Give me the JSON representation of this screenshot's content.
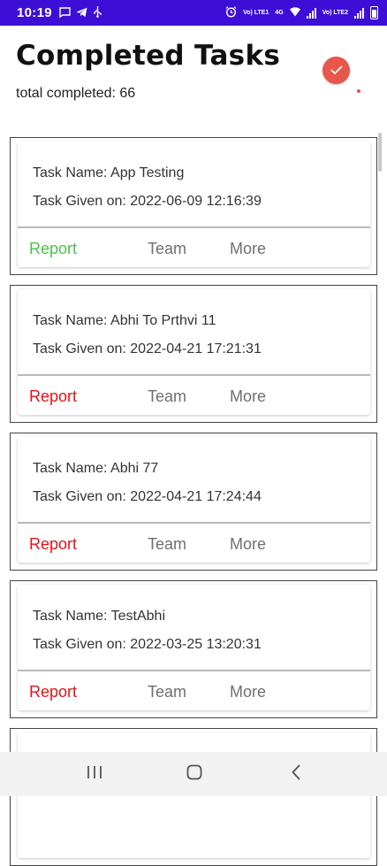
{
  "status_bar": {
    "time": "10:19",
    "left_icons": [
      "message-icon",
      "telegram-icon",
      "usb-icon"
    ],
    "right_icons": [
      "alarm-icon",
      "signal-lte1-icon",
      "wifi-icon",
      "signal-lte2-icon",
      "battery-icon"
    ],
    "network_label_1": "Vo) LTE1",
    "network_label_2": "4G",
    "network_label_3": "Vo) LTE2"
  },
  "header": {
    "title": "Completed Tasks",
    "total_label": "total completed: 66",
    "accent_color": "#e8574a"
  },
  "tasks": [
    {
      "name_line": "Task Name: App Testing",
      "date_line": "Task Given on: 2022-06-09 12:16:39",
      "report": "Report",
      "report_color": "#4cc04c",
      "team": "Team",
      "more": "More"
    },
    {
      "name_line": "Task Name: Abhi To Prthvi 11",
      "date_line": "Task Given on: 2022-04-21 17:21:31",
      "report": "Report",
      "report_color": "#e5121a",
      "team": "Team",
      "more": "More"
    },
    {
      "name_line": "Task Name: Abhi 77",
      "date_line": "Task Given on: 2022-04-21 17:24:44",
      "report": "Report",
      "report_color": "#e5121a",
      "team": "Team",
      "more": "More"
    },
    {
      "name_line": "Task Name: TestAbhi",
      "date_line": "Task Given on: 2022-03-25 13:20:31",
      "report": "Report",
      "report_color": "#e5121a",
      "team": "Team",
      "more": "More"
    }
  ],
  "nav_bar": {
    "buttons": [
      "recents-icon",
      "home-icon",
      "back-icon"
    ]
  }
}
